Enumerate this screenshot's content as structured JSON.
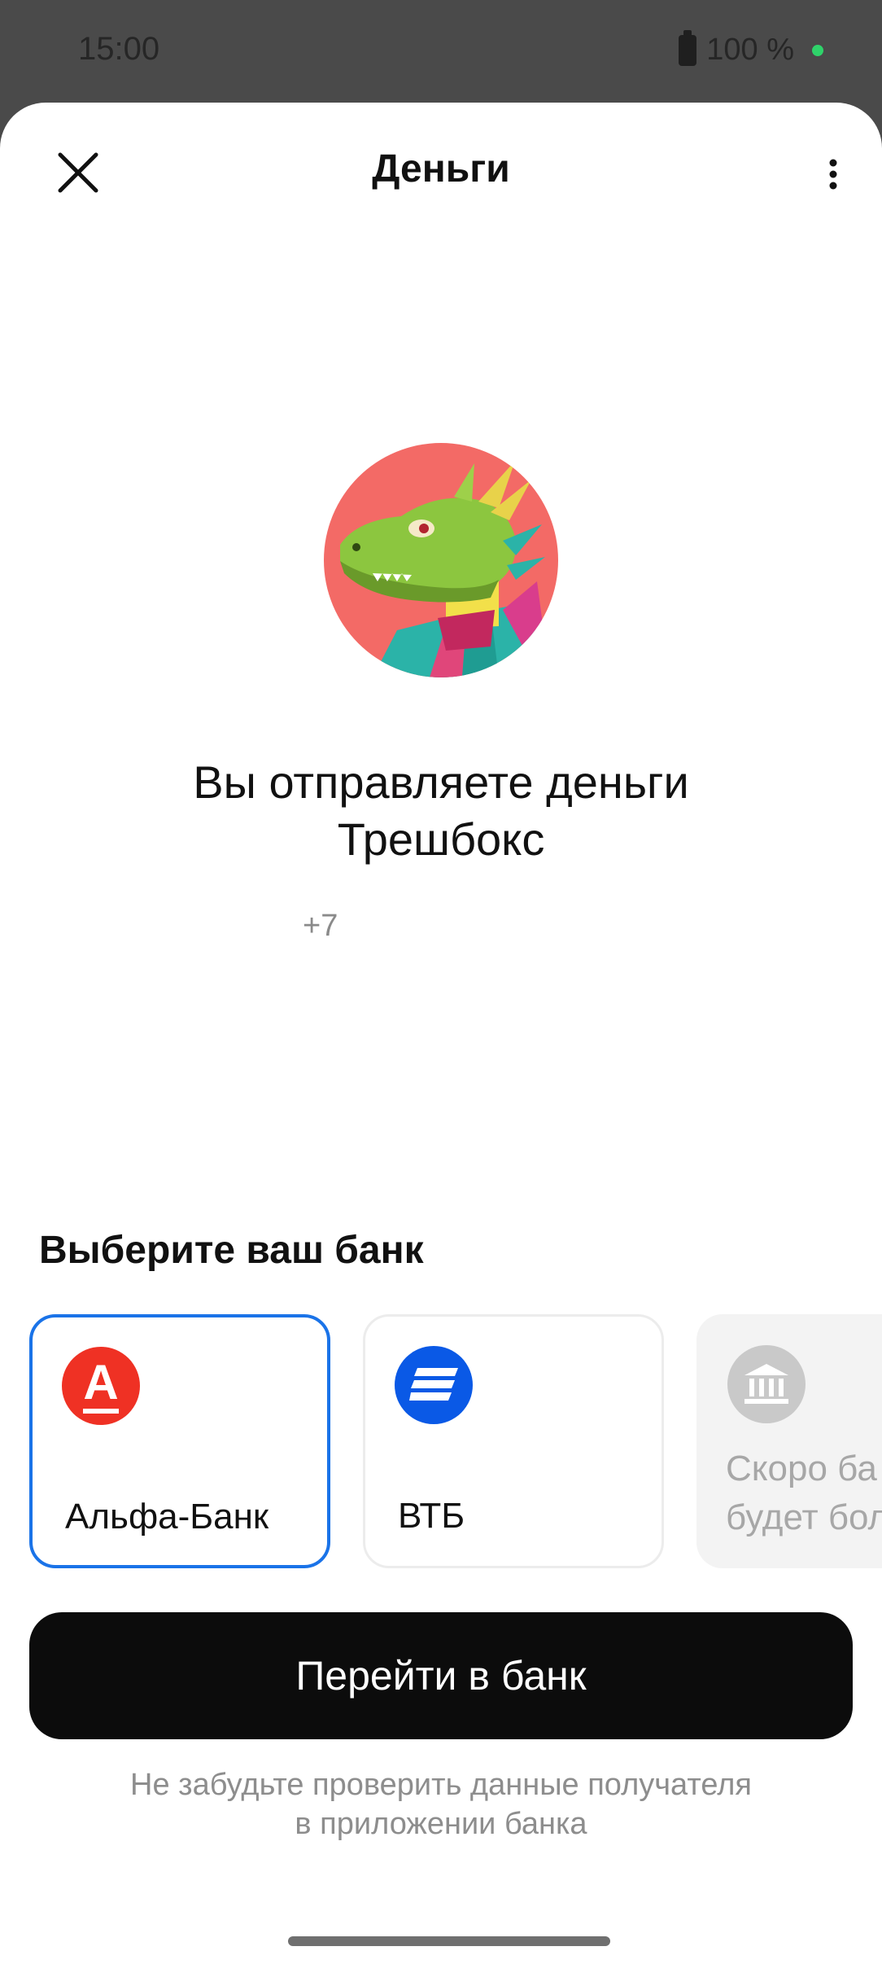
{
  "status_bar": {
    "time": "15:00",
    "battery": "100 %"
  },
  "header": {
    "title": "Деньги",
    "close_icon": "close-icon",
    "more_icon": "more-vertical-icon"
  },
  "recipient": {
    "avatar": "dragon-avatar",
    "headline_line1": "Вы отправляете деньги",
    "headline_line2": "Трешбокс",
    "phone": "+7"
  },
  "banks": {
    "heading": "Выберите ваш банк",
    "items": [
      {
        "name": "Альфа-Банк",
        "logo_letter": "А",
        "color": "#ef3124",
        "selected": true
      },
      {
        "name": "ВТБ",
        "color": "#0a59e6",
        "selected": false
      }
    ],
    "coming_soon": {
      "line1": "Скоро ба",
      "line2": "будет бол",
      "icon": "bank-building-icon"
    }
  },
  "cta": {
    "label": "Перейти в банк"
  },
  "note": {
    "line1": "Не забудьте проверить данные получателя",
    "line2": "в приложении банка"
  },
  "colors": {
    "accent": "#1a73e8",
    "cta_bg": "#0c0c0c",
    "alfa_red": "#ef3124",
    "vtb_blue": "#0a59e6"
  }
}
